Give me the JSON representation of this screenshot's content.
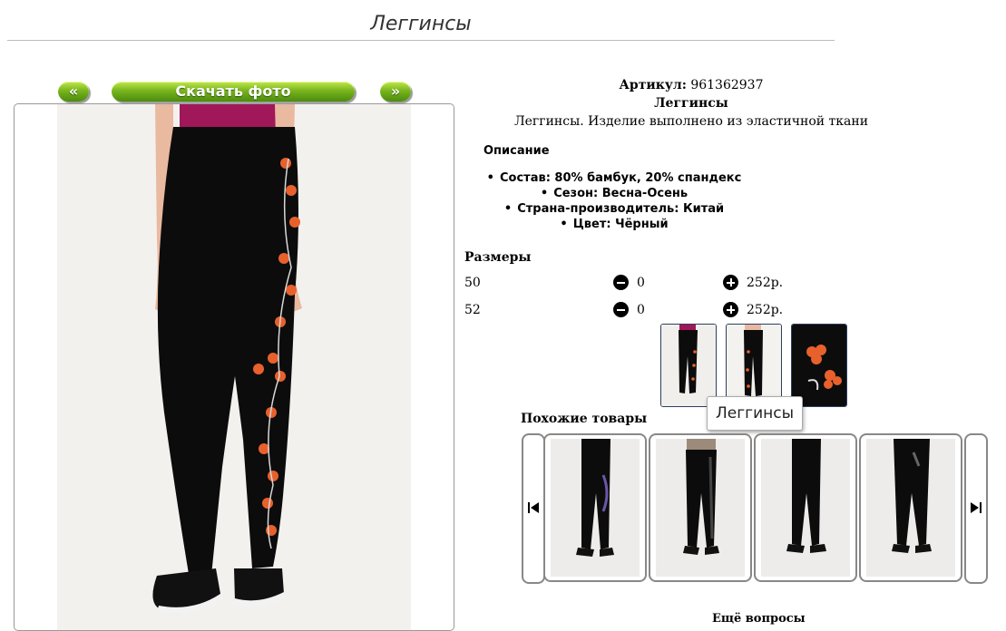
{
  "page": {
    "title": "Леггинсы"
  },
  "photo": {
    "prev_label": "«",
    "download_label": "Скачать фото",
    "next_label": "»"
  },
  "product": {
    "article_label": "Артикул:",
    "article_value": "961362937",
    "name": "Леггинсы",
    "short_desc": "Леггинсы. Изделие выполнено из эластичной ткани",
    "description_heading": "Описание",
    "properties": [
      "Состав: 80% бамбук, 20% спандекс",
      "Сезон: Весна-Осень",
      "Страна-производитель: Китай",
      "Цвет: Чёрный"
    ]
  },
  "sizes": {
    "heading": "Размеры",
    "rows": [
      {
        "size": "50",
        "qty": "0",
        "price": "252р."
      },
      {
        "size": "52",
        "qty": "0",
        "price": "252р."
      }
    ]
  },
  "tooltip": "Леггинсы",
  "similar": {
    "heading": "Похожие товары"
  },
  "footer_partial": "Ещё вопросы",
  "colors": {
    "button_green": "#6aa818",
    "leggings": "#0c0c0c",
    "flower": "#e8612c",
    "top": "#a0185a"
  },
  "icons": [
    "minus-icon",
    "plus-icon",
    "first-icon",
    "last-icon"
  ]
}
